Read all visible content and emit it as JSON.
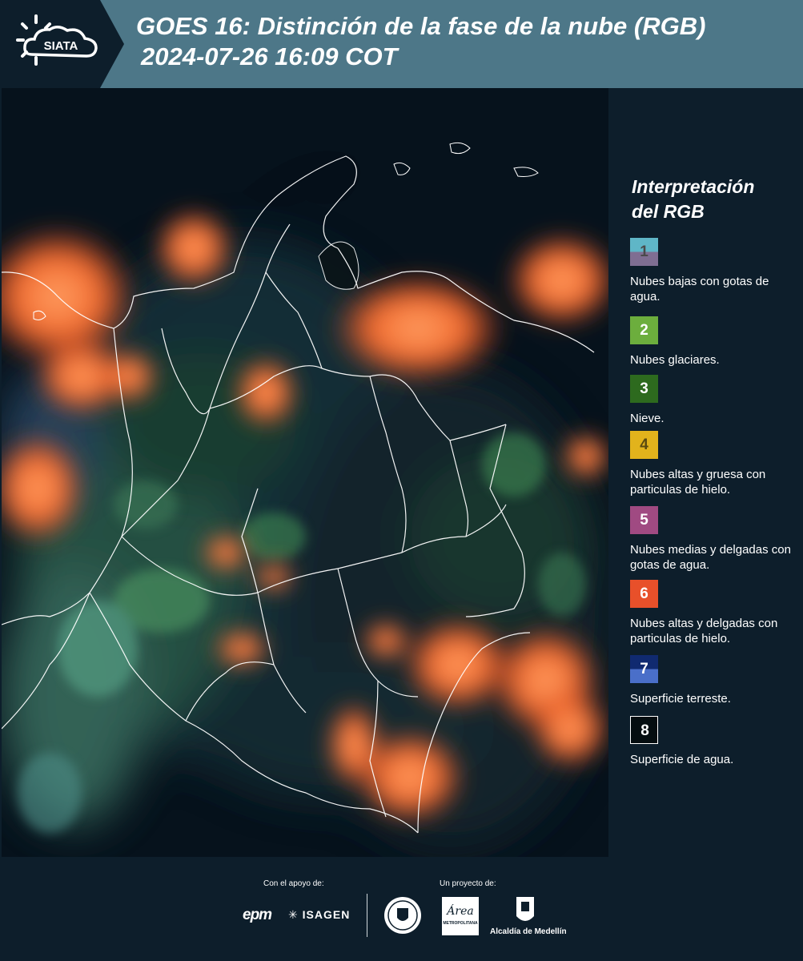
{
  "header": {
    "logo_text": "SIATA",
    "title": "GOES 16: Distinción de la fase de la nube (RGB)",
    "subtitle": "2024-07-26 16:09 COT"
  },
  "legend": {
    "title_line1": "Interpretación",
    "title_line2": "del RGB",
    "items": [
      {
        "num": "1",
        "label": "Nubes bajas con gotas de agua.",
        "colors": [
          "#5fb6c7",
          "#7f6e92"
        ],
        "num_color": "#4a4a4a"
      },
      {
        "num": "2",
        "label": "Nubes glaciares.",
        "colors": [
          "#6cae3d"
        ],
        "num_color": "#ffffff"
      },
      {
        "num": "3",
        "label": "Nieve.",
        "colors": [
          "#2d6a1e"
        ],
        "num_color": "#ffffff"
      },
      {
        "num": "4",
        "label": "Nubes altas y gruesa con particulas de hielo.",
        "colors": [
          "#e2b31c"
        ],
        "num_color": "#5a4a10"
      },
      {
        "num": "5",
        "label": "Nubes medias y delgadas con gotas de agua.",
        "colors": [
          "#a04a82"
        ],
        "num_color": "#ffffff"
      },
      {
        "num": "6",
        "label": "Nubes altas y delgadas con particulas de hielo.",
        "colors": [
          "#e8502a"
        ],
        "num_color": "#ffffff"
      },
      {
        "num": "7",
        "label": "Superficie terreste.",
        "colors": [
          "#102a70",
          "#4a6fc9"
        ],
        "num_color": "#ffffff"
      },
      {
        "num": "8",
        "label": "Superficie de agua.",
        "colors": [
          "#050d10"
        ],
        "num_color": "#ffffff"
      }
    ]
  },
  "footer": {
    "support_label": "Con el apoyo de:",
    "project_label": "Un proyecto de:",
    "epm": "epm",
    "isagen": "ISAGEN",
    "area": "Área",
    "area_sub": "METROPOLITANA",
    "alcaldia": "Alcaldía de Medellín"
  }
}
